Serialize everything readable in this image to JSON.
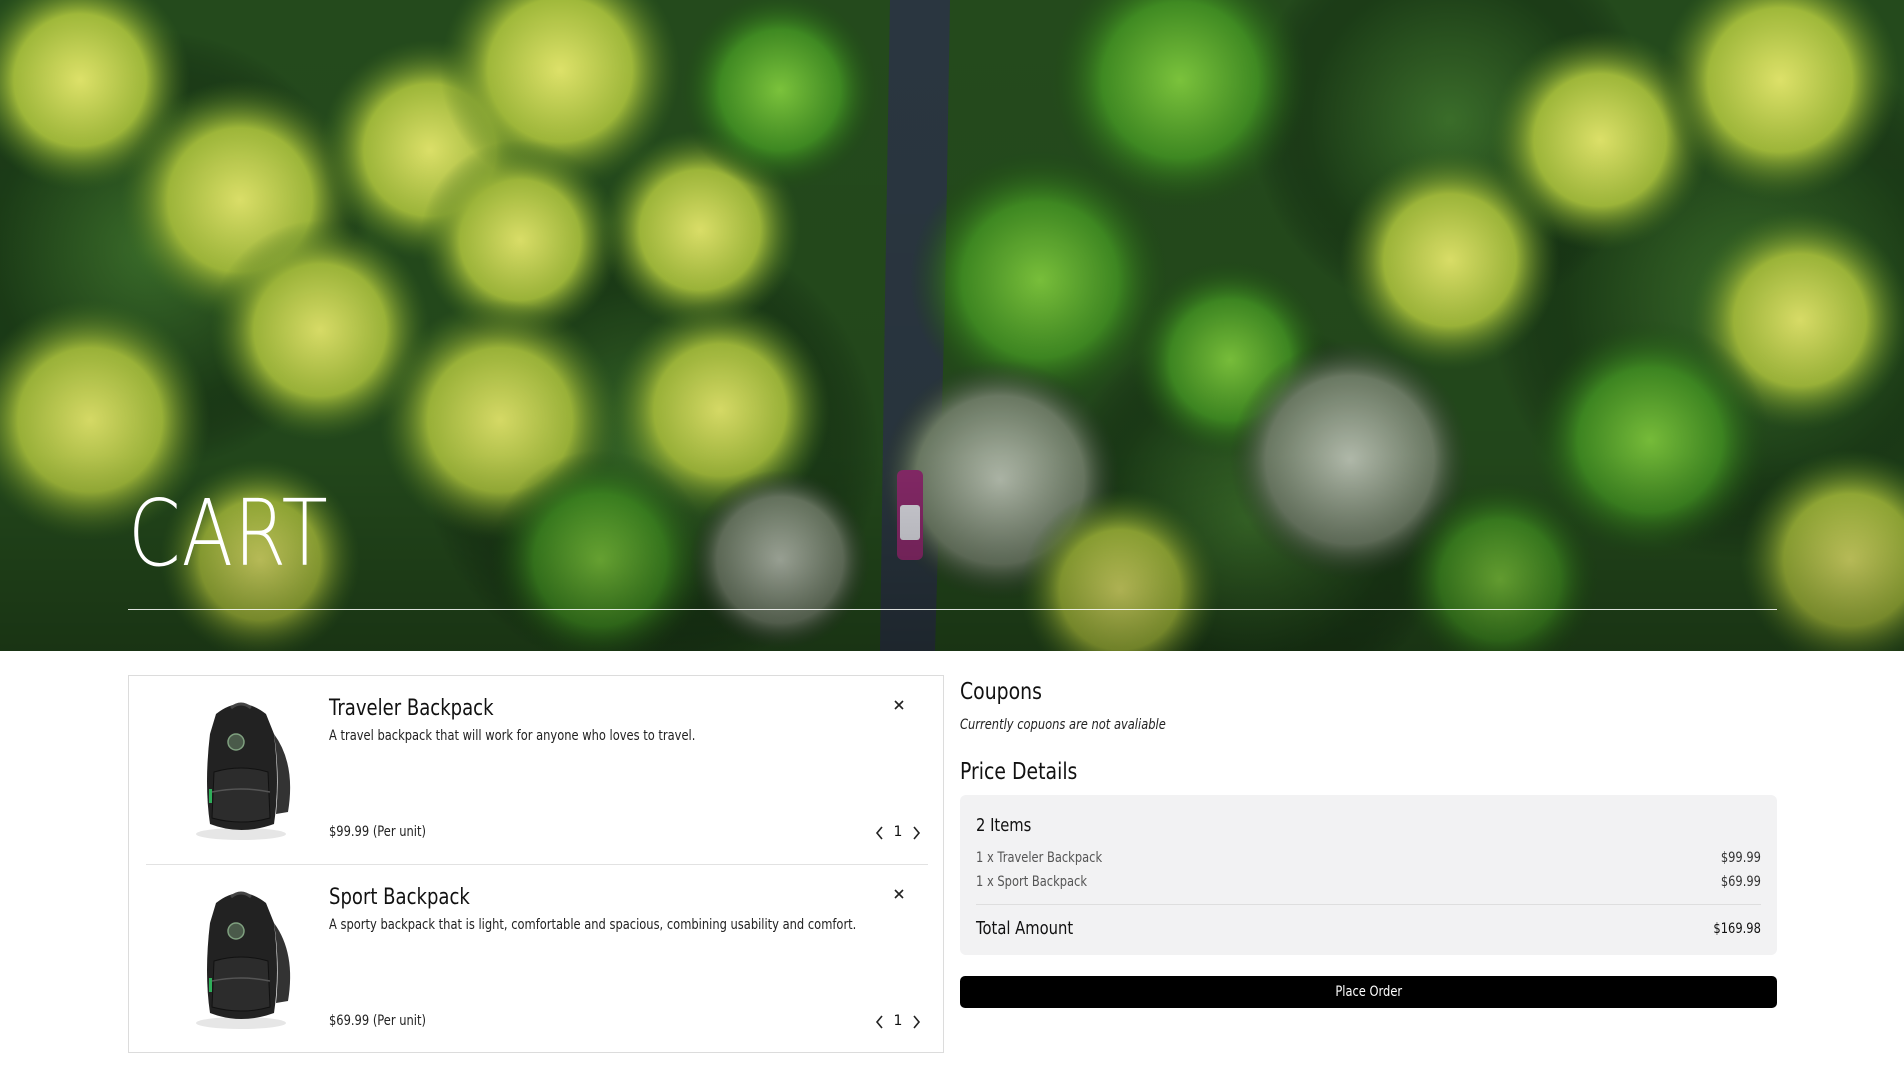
{
  "hero": {
    "title": "CART"
  },
  "cart": {
    "items": [
      {
        "name": "Traveler Backpack",
        "description": "A travel backpack that will work for anyone who loves to travel.",
        "price": "$99.99 (Per unit)",
        "quantity": "1",
        "remove_icon": "close-icon"
      },
      {
        "name": "Sport Backpack",
        "description": "A sporty backpack that is light, comfortable and spacious, combining usability and comfort.",
        "price": "$69.99 (Per unit)",
        "quantity": "1",
        "remove_icon": "close-icon"
      }
    ]
  },
  "coupons": {
    "title": "Coupons",
    "note": "Currently copuons are not avaliable"
  },
  "price_details": {
    "title": "Price Details",
    "items_count": "2 Items",
    "lines": [
      {
        "label": "1 x Traveler Backpack",
        "amount": "$99.99"
      },
      {
        "label": "1 x Sport Backpack",
        "amount": "$69.99"
      }
    ],
    "total_label": "Total Amount",
    "total_amount": "$169.98"
  },
  "actions": {
    "place_order": "Place Order"
  },
  "colors": {
    "button_bg": "#000000",
    "panel_bg": "#f2f2f3",
    "hero_text": "#ffffff"
  }
}
